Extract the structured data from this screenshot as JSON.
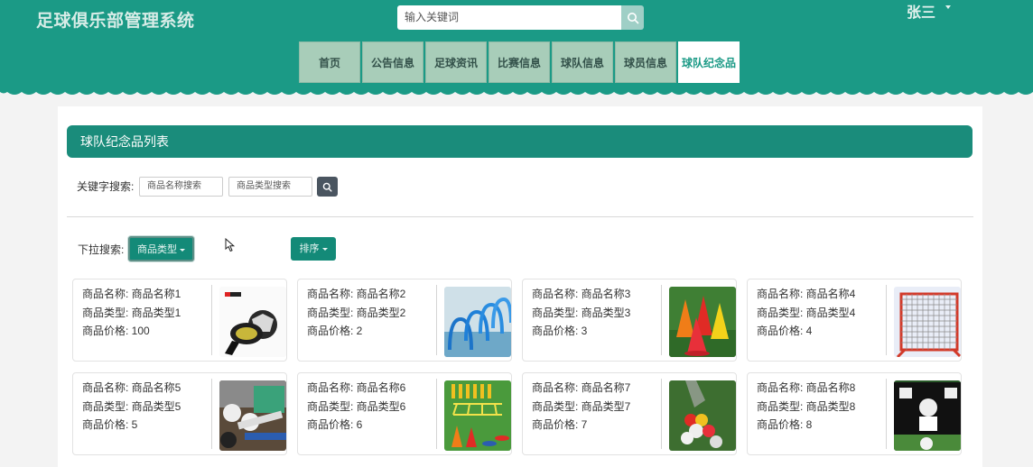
{
  "header": {
    "app_title": "足球俱乐部管理系统",
    "search_placeholder": "输入关键词",
    "user_name": "张三",
    "search_icon": "search-icon"
  },
  "nav": {
    "items": [
      {
        "label": "首页"
      },
      {
        "label": "公告信息"
      },
      {
        "label": "足球资讯"
      },
      {
        "label": "比赛信息"
      },
      {
        "label": "球队信息"
      },
      {
        "label": "球员信息"
      },
      {
        "label": "球队纪念品",
        "active": true
      }
    ]
  },
  "panel": {
    "title": "球队纪念品列表",
    "keyword_label": "关键字搜索:",
    "name_placeholder": "商品名称搜索",
    "type_placeholder": "商品类型搜索",
    "dropdown_label": "下拉搜索:",
    "type_dropdown": "商品类型",
    "sort_dropdown": "排序"
  },
  "products": [
    {
      "name": "商品名称: 商品名称1",
      "type": "商品类型: 商品类型1",
      "price": "商品价格: 100",
      "image": "rebound-trainer-ball"
    },
    {
      "name": "商品名称: 商品名称2",
      "type": "商品类型: 商品类型2",
      "price": "商品价格: 2",
      "image": "blue-hurdles"
    },
    {
      "name": "商品名称: 商品名称3",
      "type": "商品类型: 商品类型3",
      "price": "商品价格: 3",
      "image": "training-cones"
    },
    {
      "name": "商品名称: 商品名称4",
      "type": "商品类型: 商品类型4",
      "price": "商品价格: 4",
      "image": "rebounder-net"
    },
    {
      "name": "商品名称: 商品名称5",
      "type": "商品类型: 商品类型5",
      "price": "商品价格: 5",
      "image": "ball-storage"
    },
    {
      "name": "商品名称: 商品名称6",
      "type": "商品类型: 商品类型6",
      "price": "商品价格: 6",
      "image": "agility-ladder-set"
    },
    {
      "name": "商品名称: 商品名称7",
      "type": "商品类型: 商品类型7",
      "price": "商品价格: 7",
      "image": "ball-net-bag"
    },
    {
      "name": "商品名称: 商品名称8",
      "type": "商品类型: 商品类型8",
      "price": "商品价格: 8",
      "image": "target-goal"
    }
  ],
  "colors": {
    "brand": "#1b9a86",
    "panel_head": "#1a8c7b",
    "nav_bg": "#a8cdb9",
    "button": "#138a78"
  }
}
